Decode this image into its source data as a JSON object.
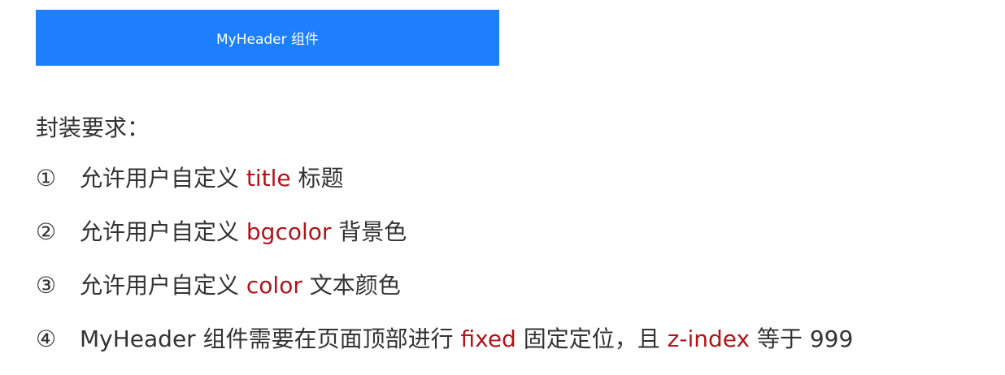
{
  "header_demo": {
    "label": "MyHeader 组件",
    "bg_color": "#1e7ffe",
    "text_color": "#ffffff"
  },
  "section_title": "封装要求：",
  "highlight_color": "#b1141b",
  "requirements": [
    {
      "number": "①",
      "prefix": "允许用户自定义 ",
      "keyword": "title",
      "suffix": " 标题"
    },
    {
      "number": "②",
      "prefix": "允许用户自定义 ",
      "keyword": "bgcolor",
      "suffix": " 背景色"
    },
    {
      "number": "③",
      "prefix": "允许用户自定义 ",
      "keyword": "color",
      "suffix": " 文本颜色"
    },
    {
      "number": "④",
      "prefix": "MyHeader 组件需要在页面顶部进行 ",
      "keyword": "fixed",
      "middle": " 固定定位，且 ",
      "keyword2": "z-index",
      "suffix": " 等于 999"
    }
  ]
}
